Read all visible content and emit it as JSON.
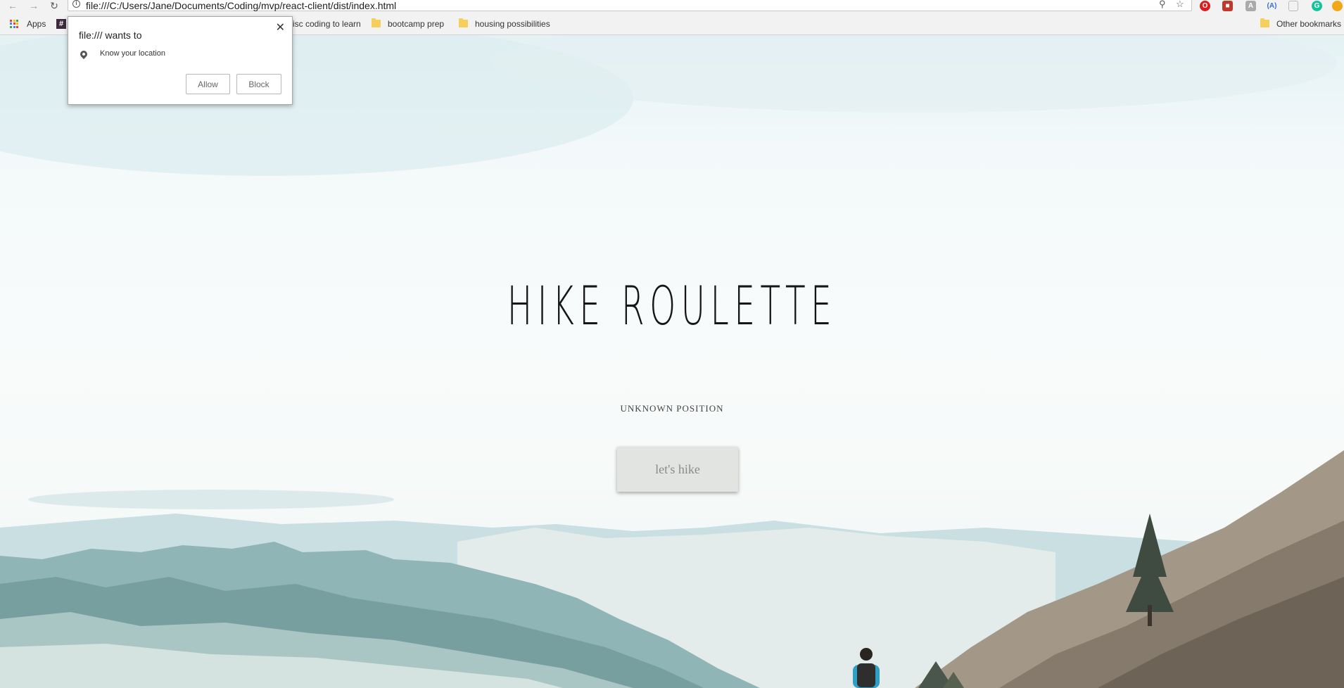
{
  "browser": {
    "url": "file:///C:/Users/Jane/Documents/Coding/mvp/react-client/dist/index.html",
    "bookmarks": [
      {
        "label": "Apps",
        "icon": "apps-grid-icon"
      },
      {
        "label": "",
        "icon": "hash-icon"
      },
      {
        "label": "isc coding to learn",
        "icon": "folder-icon"
      },
      {
        "label": "bootcamp prep",
        "icon": "folder-icon"
      },
      {
        "label": "housing possibilities",
        "icon": "folder-icon"
      }
    ],
    "other_bookmarks": "Other bookmarks",
    "extension_icons": [
      "opera-icon",
      "ext-red-icon",
      "ext-a-icon",
      "ext-a-circle-icon",
      "ext-doc-icon",
      "grammarly-icon",
      "ext-orange-icon"
    ]
  },
  "popup": {
    "title": "file:/// wants to",
    "permission": "Know your location",
    "allow_label": "Allow",
    "block_label": "Block"
  },
  "page": {
    "title": "HIKE ROULETTE",
    "position_text": "UNKNOWN POSITION",
    "button_label": "let's hike"
  },
  "colors": {
    "folder": "#f5cf5a",
    "sky": "#e4f2f4",
    "mountains": "#8fb5b6",
    "hiker_jacket": "#2f9fc4"
  }
}
